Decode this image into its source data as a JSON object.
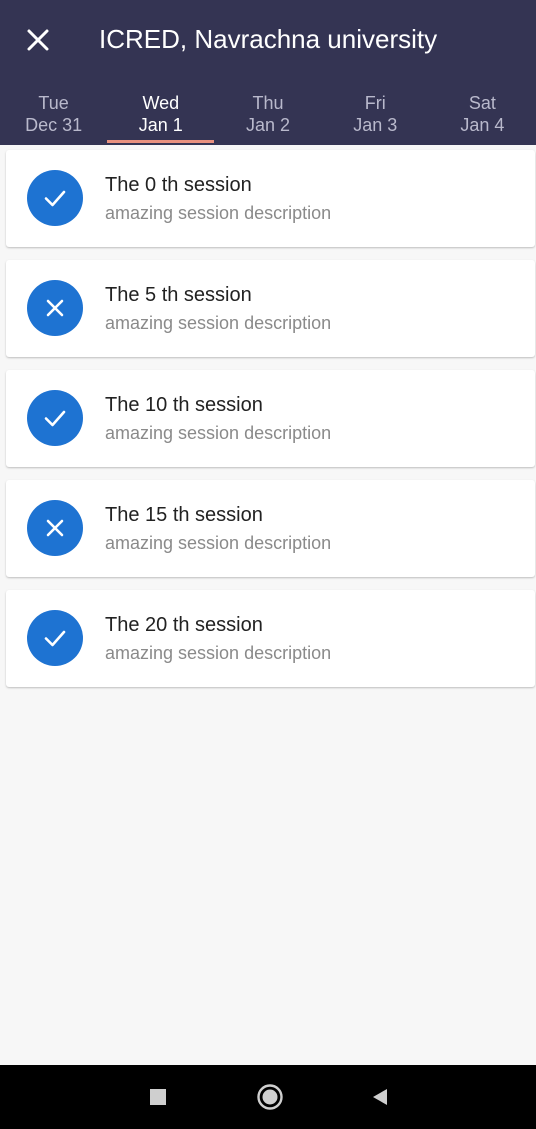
{
  "header": {
    "title": "ICRED, Navrachna university",
    "close_icon": "close-icon",
    "background": "#343453"
  },
  "tabs": [
    {
      "dow": "Tue",
      "date": "Dec 31"
    },
    {
      "dow": "Wed",
      "date": "Jan 1",
      "active": true
    },
    {
      "dow": "Thu",
      "date": "Jan 2"
    },
    {
      "dow": "Fri",
      "date": "Jan 3"
    },
    {
      "dow": "Sat",
      "date": "Jan 4"
    }
  ],
  "accent_color": "#e8907e",
  "status_color": "#1e73d2",
  "sessions": [
    {
      "title": "The 0 th session",
      "description": "amazing session description",
      "status": "check-icon"
    },
    {
      "title": "The 5 th session",
      "description": "amazing session description",
      "status": "close-icon"
    },
    {
      "title": "The 10 th session",
      "description": "amazing session description",
      "status": "check-icon"
    },
    {
      "title": "The 15 th session",
      "description": "amazing session description",
      "status": "close-icon"
    },
    {
      "title": "The 20 th session",
      "description": "amazing session description",
      "status": "check-icon"
    }
  ],
  "navbar": {
    "icons": [
      "square-icon",
      "circle-icon",
      "triangle-back-icon"
    ]
  }
}
